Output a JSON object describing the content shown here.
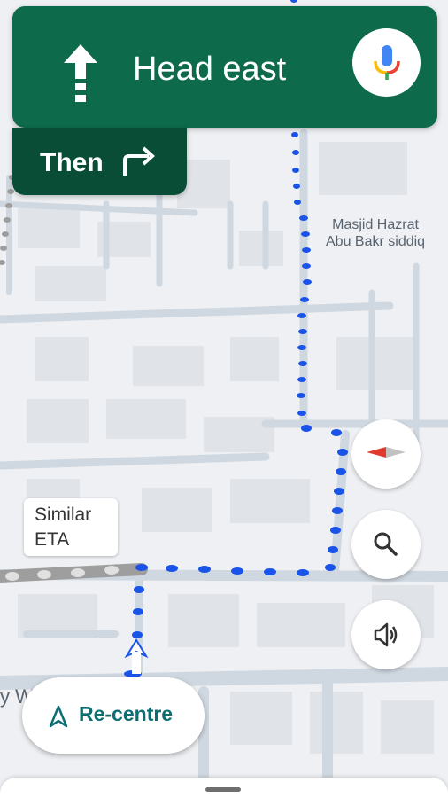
{
  "navigation": {
    "instruction": "Head east",
    "then_label": "Then",
    "maneuver_icon": "straight-arrow-icon",
    "next_maneuver_icon": "turn-right-icon",
    "voice_icon": "microphone-icon"
  },
  "map": {
    "place_label_line1": "Masjid Hazrat",
    "place_label_line2": "Abu Bakr siddiq",
    "street_fragment": "y W",
    "route_color": "#1a53e8",
    "alt_route_color": "#9e9e9e"
  },
  "eta_bubble": {
    "line1": "Similar",
    "line2": "ETA"
  },
  "controls": {
    "compass_icon": "compass-icon",
    "search_icon": "search-icon",
    "sound_icon": "volume-icon",
    "recentre_label": "Re-centre",
    "recentre_icon": "navigation-arrow-icon"
  },
  "colors": {
    "nav_primary": "#0d6a4a",
    "nav_secondary": "#0a4d37",
    "recentre_text": "#0b6e72"
  }
}
